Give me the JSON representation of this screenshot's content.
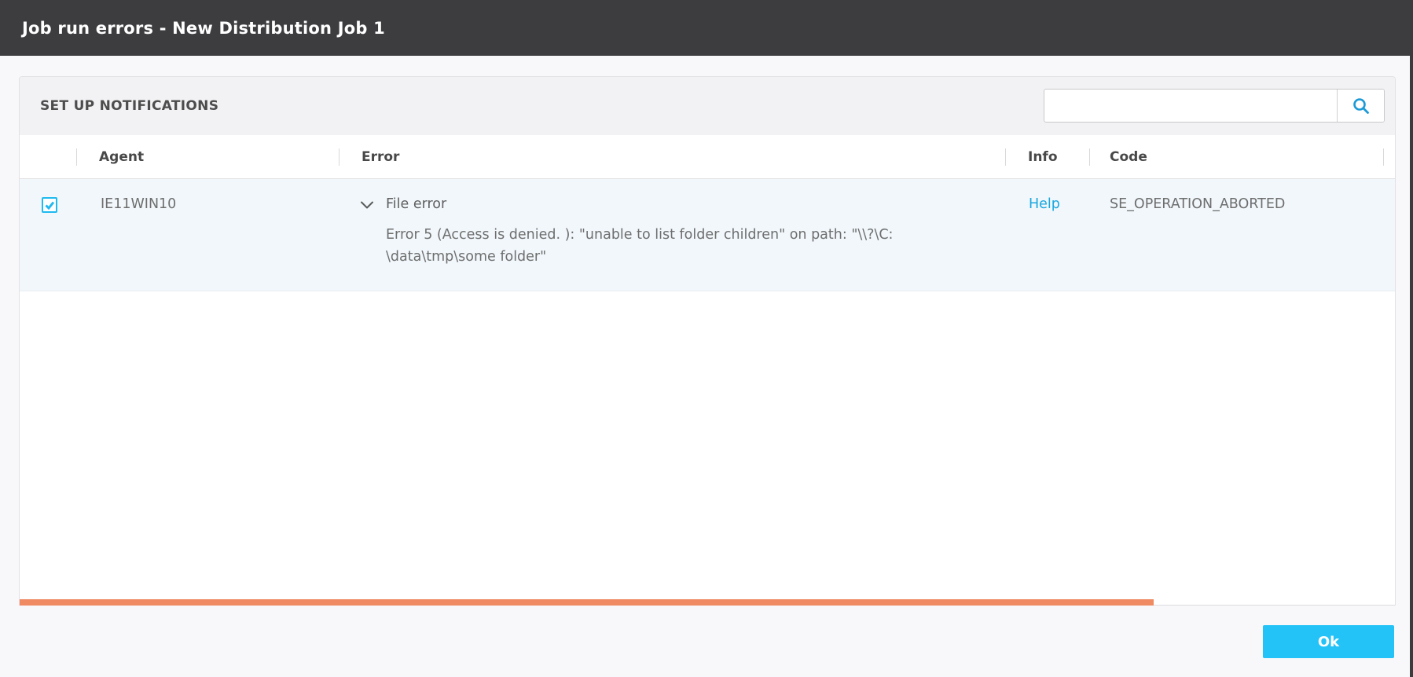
{
  "titlebar": {
    "title": "Job run errors - New Distribution Job 1"
  },
  "panel": {
    "section_title": "SET UP NOTIFICATIONS",
    "search": {
      "value": "",
      "placeholder": ""
    }
  },
  "table": {
    "columns": [
      "Agent",
      "Error",
      "Info",
      "Code"
    ],
    "rows": [
      {
        "checked": true,
        "agent": "IE11WIN10",
        "error_type": "File error",
        "error_detail_line1": "Error 5 (Access is denied. ): \"unable to list folder children\" on path: \"\\\\?\\C:",
        "error_detail_line2": "\\data\\tmp\\some folder\"",
        "info_link": "Help",
        "code": "SE_OPERATION_ABORTED"
      }
    ]
  },
  "progress": {
    "percent": 82
  },
  "footer": {
    "ok_label": "Ok"
  },
  "colors": {
    "titlebar_bg": "#3d3d40",
    "accent_cyan": "#23c3f7",
    "link_blue": "#1ba7df",
    "checkbox_cyan": "#1fbaf0",
    "progress_orange": "#ef8a63",
    "row_bg": "#f1f7fb"
  }
}
